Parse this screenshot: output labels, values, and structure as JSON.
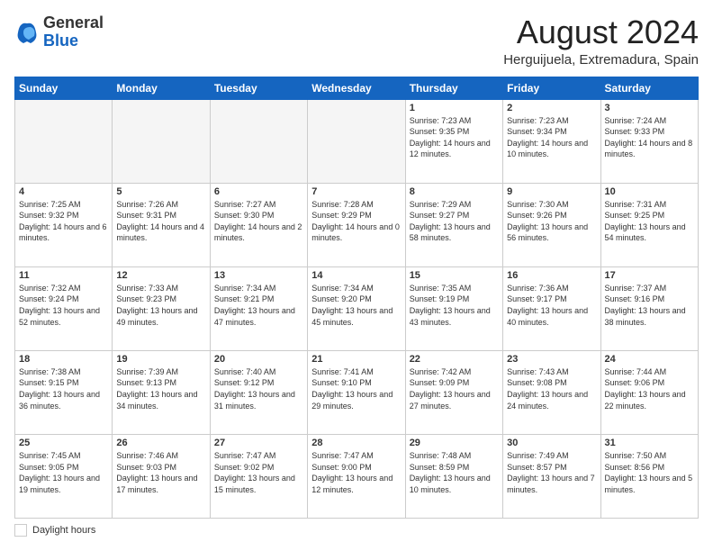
{
  "header": {
    "logo": {
      "general": "General",
      "blue": "Blue"
    },
    "title": "August 2024",
    "location": "Herguijuela, Extremadura, Spain"
  },
  "calendar": {
    "days_of_week": [
      "Sunday",
      "Monday",
      "Tuesday",
      "Wednesday",
      "Thursday",
      "Friday",
      "Saturday"
    ],
    "weeks": [
      [
        {
          "day": "",
          "info": ""
        },
        {
          "day": "",
          "info": ""
        },
        {
          "day": "",
          "info": ""
        },
        {
          "day": "",
          "info": ""
        },
        {
          "day": "1",
          "info": "Sunrise: 7:23 AM\nSunset: 9:35 PM\nDaylight: 14 hours and 12 minutes."
        },
        {
          "day": "2",
          "info": "Sunrise: 7:23 AM\nSunset: 9:34 PM\nDaylight: 14 hours and 10 minutes."
        },
        {
          "day": "3",
          "info": "Sunrise: 7:24 AM\nSunset: 9:33 PM\nDaylight: 14 hours and 8 minutes."
        }
      ],
      [
        {
          "day": "4",
          "info": "Sunrise: 7:25 AM\nSunset: 9:32 PM\nDaylight: 14 hours and 6 minutes."
        },
        {
          "day": "5",
          "info": "Sunrise: 7:26 AM\nSunset: 9:31 PM\nDaylight: 14 hours and 4 minutes."
        },
        {
          "day": "6",
          "info": "Sunrise: 7:27 AM\nSunset: 9:30 PM\nDaylight: 14 hours and 2 minutes."
        },
        {
          "day": "7",
          "info": "Sunrise: 7:28 AM\nSunset: 9:29 PM\nDaylight: 14 hours and 0 minutes."
        },
        {
          "day": "8",
          "info": "Sunrise: 7:29 AM\nSunset: 9:27 PM\nDaylight: 13 hours and 58 minutes."
        },
        {
          "day": "9",
          "info": "Sunrise: 7:30 AM\nSunset: 9:26 PM\nDaylight: 13 hours and 56 minutes."
        },
        {
          "day": "10",
          "info": "Sunrise: 7:31 AM\nSunset: 9:25 PM\nDaylight: 13 hours and 54 minutes."
        }
      ],
      [
        {
          "day": "11",
          "info": "Sunrise: 7:32 AM\nSunset: 9:24 PM\nDaylight: 13 hours and 52 minutes."
        },
        {
          "day": "12",
          "info": "Sunrise: 7:33 AM\nSunset: 9:23 PM\nDaylight: 13 hours and 49 minutes."
        },
        {
          "day": "13",
          "info": "Sunrise: 7:34 AM\nSunset: 9:21 PM\nDaylight: 13 hours and 47 minutes."
        },
        {
          "day": "14",
          "info": "Sunrise: 7:34 AM\nSunset: 9:20 PM\nDaylight: 13 hours and 45 minutes."
        },
        {
          "day": "15",
          "info": "Sunrise: 7:35 AM\nSunset: 9:19 PM\nDaylight: 13 hours and 43 minutes."
        },
        {
          "day": "16",
          "info": "Sunrise: 7:36 AM\nSunset: 9:17 PM\nDaylight: 13 hours and 40 minutes."
        },
        {
          "day": "17",
          "info": "Sunrise: 7:37 AM\nSunset: 9:16 PM\nDaylight: 13 hours and 38 minutes."
        }
      ],
      [
        {
          "day": "18",
          "info": "Sunrise: 7:38 AM\nSunset: 9:15 PM\nDaylight: 13 hours and 36 minutes."
        },
        {
          "day": "19",
          "info": "Sunrise: 7:39 AM\nSunset: 9:13 PM\nDaylight: 13 hours and 34 minutes."
        },
        {
          "day": "20",
          "info": "Sunrise: 7:40 AM\nSunset: 9:12 PM\nDaylight: 13 hours and 31 minutes."
        },
        {
          "day": "21",
          "info": "Sunrise: 7:41 AM\nSunset: 9:10 PM\nDaylight: 13 hours and 29 minutes."
        },
        {
          "day": "22",
          "info": "Sunrise: 7:42 AM\nSunset: 9:09 PM\nDaylight: 13 hours and 27 minutes."
        },
        {
          "day": "23",
          "info": "Sunrise: 7:43 AM\nSunset: 9:08 PM\nDaylight: 13 hours and 24 minutes."
        },
        {
          "day": "24",
          "info": "Sunrise: 7:44 AM\nSunset: 9:06 PM\nDaylight: 13 hours and 22 minutes."
        }
      ],
      [
        {
          "day": "25",
          "info": "Sunrise: 7:45 AM\nSunset: 9:05 PM\nDaylight: 13 hours and 19 minutes."
        },
        {
          "day": "26",
          "info": "Sunrise: 7:46 AM\nSunset: 9:03 PM\nDaylight: 13 hours and 17 minutes."
        },
        {
          "day": "27",
          "info": "Sunrise: 7:47 AM\nSunset: 9:02 PM\nDaylight: 13 hours and 15 minutes."
        },
        {
          "day": "28",
          "info": "Sunrise: 7:47 AM\nSunset: 9:00 PM\nDaylight: 13 hours and 12 minutes."
        },
        {
          "day": "29",
          "info": "Sunrise: 7:48 AM\nSunset: 8:59 PM\nDaylight: 13 hours and 10 minutes."
        },
        {
          "day": "30",
          "info": "Sunrise: 7:49 AM\nSunset: 8:57 PM\nDaylight: 13 hours and 7 minutes."
        },
        {
          "day": "31",
          "info": "Sunrise: 7:50 AM\nSunset: 8:56 PM\nDaylight: 13 hours and 5 minutes."
        }
      ]
    ]
  },
  "footer": {
    "label": "Daylight hours"
  }
}
